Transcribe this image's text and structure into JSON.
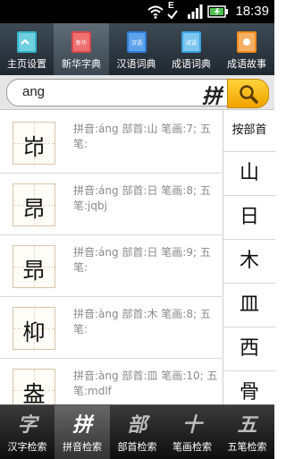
{
  "status_bar": {
    "time": "18:39",
    "network_letter": "E"
  },
  "top_nav": [
    {
      "label": "主页设置",
      "icon": "home-settings-book-icon",
      "color": "#37b3c9"
    },
    {
      "label": "新华字典",
      "icon": "xinhua-dictionary-book-icon",
      "color": "#d84a4a",
      "active": true,
      "badge": "新华"
    },
    {
      "label": "汉语词典",
      "icon": "chinese-dictionary-book-icon",
      "color": "#2f7fd8",
      "badge": "汉语"
    },
    {
      "label": "成语词典",
      "icon": "idiom-dictionary-book-icon",
      "color": "#3aa3e0",
      "badge": "成语"
    },
    {
      "label": "成语故事",
      "icon": "idiom-story-book-icon",
      "color": "#f08a1c"
    }
  ],
  "search": {
    "value": "ang",
    "mode_glyph": "拼"
  },
  "results": [
    {
      "char": "岇",
      "info": "拼音:áng 部首:山 笔画:7; 五笔:"
    },
    {
      "char": "昂",
      "info": "拼音:áng 部首:日 笔画:8; 五笔:jqbj"
    },
    {
      "char": "昻",
      "info": "拼音:áng 部首:日 笔画:9; 五笔:"
    },
    {
      "char": "枊",
      "info": "拼音:àng 部首:木 笔画:8; 五笔:"
    },
    {
      "char": "盎",
      "info": "拼音:àng 部首:皿 笔画:10; 五笔:mdlf"
    }
  ],
  "radical_panel": {
    "header": "按部首",
    "radicals": [
      "山",
      "日",
      "木",
      "皿",
      "西",
      "骨"
    ]
  },
  "bottom_nav": [
    {
      "glyph": "字",
      "label": "汉字检索"
    },
    {
      "glyph": "拼",
      "label": "拼音检索",
      "active": true
    },
    {
      "glyph": "部",
      "label": "部首检索"
    },
    {
      "glyph": "十",
      "label": "笔画检索"
    },
    {
      "glyph": "五",
      "label": "五笔检索"
    }
  ]
}
